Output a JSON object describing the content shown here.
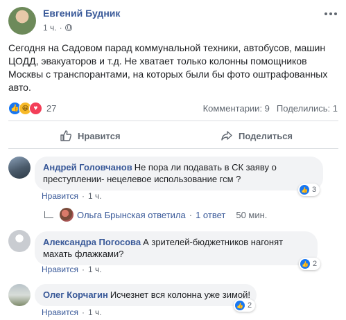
{
  "post": {
    "author": "Евгений Будник",
    "time": "1 ч.",
    "text": "Сегодня на Садовом парад коммунальной техники, автобусов, машин ЦОДД, эвакуаторов и т.д. Не хватает только колонны помощников Москвы с транспорантами, на которых были бы фото оштрафованных авто.",
    "reaction_count": "27",
    "comments_stat": "Комментарии: 9",
    "shares_stat": "Поделились: 1"
  },
  "actions": {
    "like": "Нравится",
    "share": "Поделиться"
  },
  "comments": [
    {
      "author": "Андрей Головчанов",
      "text": "Не пора ли подавать в СК заяву о преступлении- нецелевое использование гсм ?",
      "like_label": "Нравится",
      "separator": "·",
      "time": "1 ч.",
      "reactions": "3"
    },
    {
      "author": "Александра Погосова",
      "text": "А зрителей-бюджетников нагонят махать флажками?",
      "like_label": "Нравится",
      "separator": "·",
      "time": "1 ч.",
      "reactions": "2"
    },
    {
      "author": "Олег Корчагин",
      "text": "Исчезнет вся колонна уже зимой!",
      "like_label": "Нравится",
      "separator": "·",
      "time": "1 ч.",
      "reactions": "2"
    }
  ],
  "reply": {
    "text": "Ольга Брынская ответила",
    "sep": "·",
    "count": "1 ответ",
    "time": "50 мин."
  },
  "colors": {
    "link": "#385898",
    "like_blue": "#1877f2",
    "bubble": "#f2f3f5"
  }
}
